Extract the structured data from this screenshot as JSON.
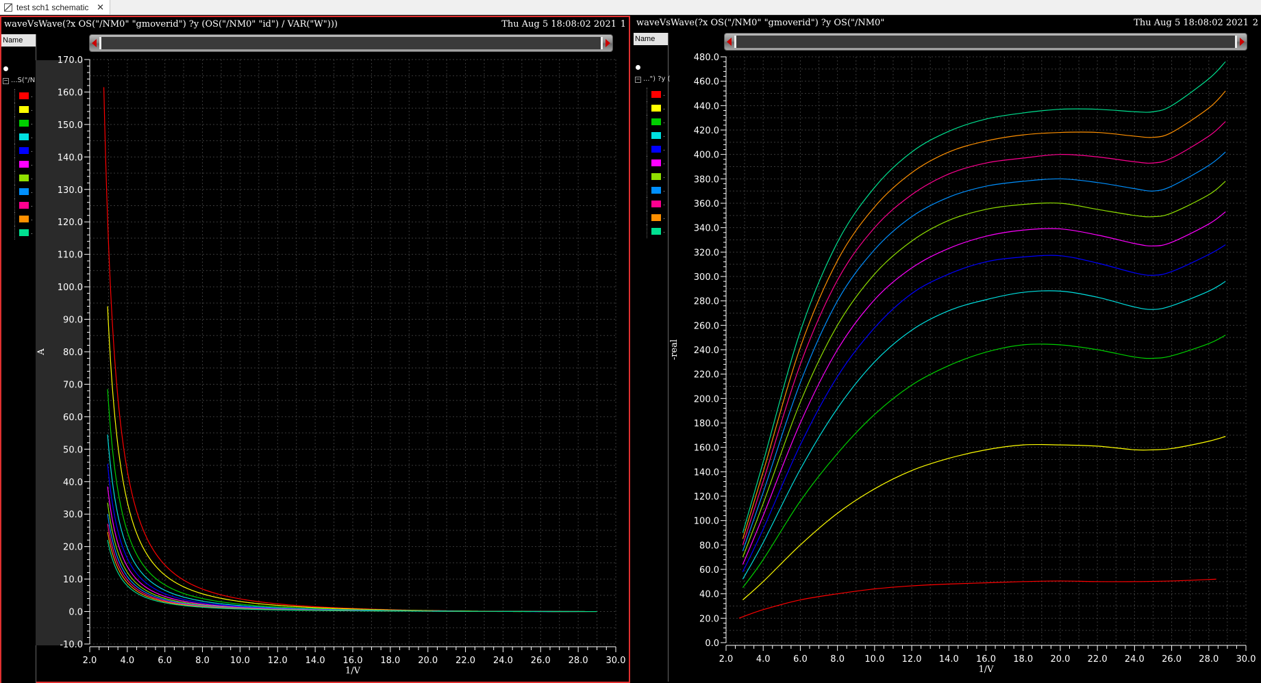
{
  "tab": {
    "label": "test sch1 schematic",
    "close": "✕"
  },
  "panels": [
    {
      "title": "waveVsWave(?x OS(\"/NM0\" \"gmoverid\") ?y (OS(\"/NM0\" \"id\") / VAR(\"W\")))",
      "datetime": "Thu Aug 5 18:08:02 2021",
      "number": "1",
      "legend_header": "Name",
      "legend_group": "...S(\"/N",
      "ylabel": "A",
      "xlabel": "1/V"
    },
    {
      "title": "waveVsWave(?x OS(\"/NM0\" \"gmoverid\") ?y OS(\"/NM0\"",
      "datetime": "Thu Aug 5 18:08:02 2021",
      "number": "2",
      "legend_header": "Name",
      "legend_group": "...\") ?y (",
      "ylabel": "-real",
      "xlabel": "1/V"
    }
  ],
  "series_colors": [
    "#ff0000",
    "#ffff00",
    "#00d000",
    "#00e0e0",
    "#0000ff",
    "#ff00ff",
    "#90e000",
    "#0090ff",
    "#ff0090",
    "#ff9000",
    "#00e090"
  ],
  "chart_data": [
    {
      "type": "line",
      "xlabel": "1/V",
      "ylabel": "A",
      "xlim": [
        2.0,
        30.0
      ],
      "ylim": [
        -10.0,
        170.0
      ],
      "xticks": [
        "2.0",
        "4.0",
        "6.0",
        "8.0",
        "10.0",
        "12.0",
        "14.0",
        "16.0",
        "18.0",
        "20.0",
        "22.0",
        "24.0",
        "26.0",
        "28.0",
        "30.0"
      ],
      "yticks": [
        "-10.0",
        "0.0",
        "10.0",
        "20.0",
        "30.0",
        "40.0",
        "50.0",
        "60.0",
        "70.0",
        "80.0",
        "90.0",
        "100.0",
        "110.0",
        "120.0",
        "130.0",
        "140.0",
        "150.0",
        "160.0",
        "170.0"
      ],
      "grid": true,
      "series": [
        {
          "x0": 2.75,
          "y0": 161.5,
          "x_end": 24.0
        },
        {
          "x0": 2.95,
          "y0": 94.0,
          "x_end": 25.0
        },
        {
          "x0": 2.95,
          "y0": 68.5,
          "x_end": 25.5
        },
        {
          "x0": 2.95,
          "y0": 54.5,
          "x_end": 26.0
        },
        {
          "x0": 2.95,
          "y0": 45.5,
          "x_end": 26.5
        },
        {
          "x0": 2.95,
          "y0": 38.5,
          "x_end": 27.0
        },
        {
          "x0": 2.95,
          "y0": 33.5,
          "x_end": 27.5
        },
        {
          "x0": 2.95,
          "y0": 30.0,
          "x_end": 28.0
        },
        {
          "x0": 2.95,
          "y0": 27.0,
          "x_end": 28.5
        },
        {
          "x0": 2.95,
          "y0": 24.5,
          "x_end": 29.0
        },
        {
          "x0": 2.95,
          "y0": 22.0,
          "x_end": 29.0
        }
      ]
    },
    {
      "type": "line",
      "xlabel": "1/V",
      "ylabel": "-real",
      "xlim": [
        2.0,
        30.0
      ],
      "ylim": [
        0.0,
        480.0
      ],
      "xticks": [
        "2.0",
        "4.0",
        "6.0",
        "8.0",
        "10.0",
        "12.0",
        "14.0",
        "16.0",
        "18.0",
        "20.0",
        "22.0",
        "24.0",
        "26.0",
        "28.0",
        "30.0"
      ],
      "yticks": [
        "0.0",
        "20.0",
        "40.0",
        "60.0",
        "80.0",
        "100.0",
        "120.0",
        "140.0",
        "160.0",
        "180.0",
        "200.0",
        "220.0",
        "240.0",
        "260.0",
        "280.0",
        "300.0",
        "320.0",
        "340.0",
        "360.0",
        "380.0",
        "400.0",
        "420.0",
        "440.0",
        "460.0",
        "480.0"
      ],
      "grid": true,
      "series": [
        {
          "x": [
            2.7,
            4.0,
            6.0,
            8.0,
            10.0,
            12.0,
            14.0,
            16.0,
            18.0,
            20.0,
            22.0,
            24.0,
            26.0,
            28.4
          ],
          "y": [
            20,
            27,
            35,
            40,
            44,
            46.5,
            48,
            49,
            50,
            50.5,
            50,
            50,
            50.5,
            52
          ]
        },
        {
          "x": [
            2.9,
            4.0,
            6.0,
            8.0,
            10.0,
            12.0,
            14.0,
            16.0,
            18.0,
            20.0,
            22.0,
            24.0,
            25.0,
            26.0,
            28.0,
            28.9
          ],
          "y": [
            35,
            50,
            80,
            106,
            126,
            141,
            151,
            158,
            162,
            162,
            161,
            158,
            158,
            159,
            165,
            169
          ]
        },
        {
          "x": [
            2.9,
            4.0,
            6.0,
            8.0,
            10.0,
            12.0,
            14.0,
            16.0,
            18.0,
            20.0,
            22.0,
            24.0,
            25.0,
            26.0,
            28.0,
            28.9
          ],
          "y": [
            45,
            68,
            116,
            155,
            187,
            211,
            227,
            238,
            244,
            244,
            240,
            234,
            233,
            235,
            245,
            252
          ]
        },
        {
          "x": [
            2.9,
            4.0,
            6.0,
            8.0,
            10.0,
            12.0,
            14.0,
            16.0,
            18.0,
            20.0,
            22.0,
            24.0,
            25.0,
            26.0,
            28.0,
            28.9
          ],
          "y": [
            52,
            82,
            142,
            192,
            230,
            256,
            272,
            281,
            287,
            288,
            283,
            275,
            273,
            276,
            288,
            296
          ]
        },
        {
          "x": [
            2.9,
            4.0,
            6.0,
            8.0,
            10.0,
            12.0,
            14.0,
            16.0,
            18.0,
            20.0,
            22.0,
            24.0,
            25.0,
            26.0,
            28.0,
            28.9
          ],
          "y": [
            58,
            93,
            162,
            218,
            258,
            286,
            302,
            312,
            316,
            317,
            311,
            303,
            301,
            304,
            318,
            326
          ]
        },
        {
          "x": [
            2.9,
            4.0,
            6.0,
            8.0,
            10.0,
            12.0,
            14.0,
            16.0,
            18.0,
            20.0,
            22.0,
            24.0,
            25.0,
            26.0,
            28.0,
            28.9
          ],
          "y": [
            64,
            104,
            180,
            240,
            281,
            307,
            323,
            333,
            338,
            339,
            334,
            327,
            325,
            328,
            343,
            353
          ]
        },
        {
          "x": [
            2.9,
            4.0,
            6.0,
            8.0,
            10.0,
            12.0,
            14.0,
            16.0,
            18.0,
            20.0,
            22.0,
            24.0,
            25.0,
            26.0,
            28.0,
            28.9
          ],
          "y": [
            70,
            114,
            197,
            260,
            302,
            329,
            346,
            355,
            359,
            360,
            355,
            350,
            349,
            352,
            367,
            378
          ]
        },
        {
          "x": [
            2.9,
            4.0,
            6.0,
            8.0,
            10.0,
            12.0,
            14.0,
            16.0,
            18.0,
            20.0,
            22.0,
            24.0,
            25.0,
            26.0,
            28.0,
            28.9
          ],
          "y": [
            75,
            123,
            213,
            280,
            322,
            349,
            365,
            374,
            378,
            380,
            377,
            372,
            370,
            374,
            391,
            402
          ]
        },
        {
          "x": [
            2.9,
            4.0,
            6.0,
            8.0,
            10.0,
            12.0,
            14.0,
            16.0,
            18.0,
            20.0,
            22.0,
            24.0,
            25.0,
            26.0,
            28.0,
            28.9
          ],
          "y": [
            80,
            132,
            228,
            297,
            340,
            367,
            384,
            393,
            397,
            400,
            398,
            394,
            393,
            397,
            415,
            427
          ]
        },
        {
          "x": [
            2.9,
            4.0,
            6.0,
            8.0,
            10.0,
            12.0,
            14.0,
            16.0,
            18.0,
            20.0,
            22.0,
            24.0,
            25.0,
            26.0,
            28.0,
            28.9
          ],
          "y": [
            85,
            140,
            242,
            313,
            357,
            385,
            402,
            411,
            416,
            418,
            418,
            415,
            414,
            418,
            438,
            452
          ]
        },
        {
          "x": [
            2.9,
            4.0,
            6.0,
            8.0,
            10.0,
            12.0,
            14.0,
            16.0,
            18.0,
            20.0,
            22.0,
            24.0,
            25.0,
            26.0,
            28.0,
            28.9
          ],
          "y": [
            90,
            148,
            255,
            328,
            373,
            402,
            419,
            429,
            434,
            437,
            437,
            435,
            435,
            440,
            462,
            476
          ]
        }
      ]
    }
  ]
}
